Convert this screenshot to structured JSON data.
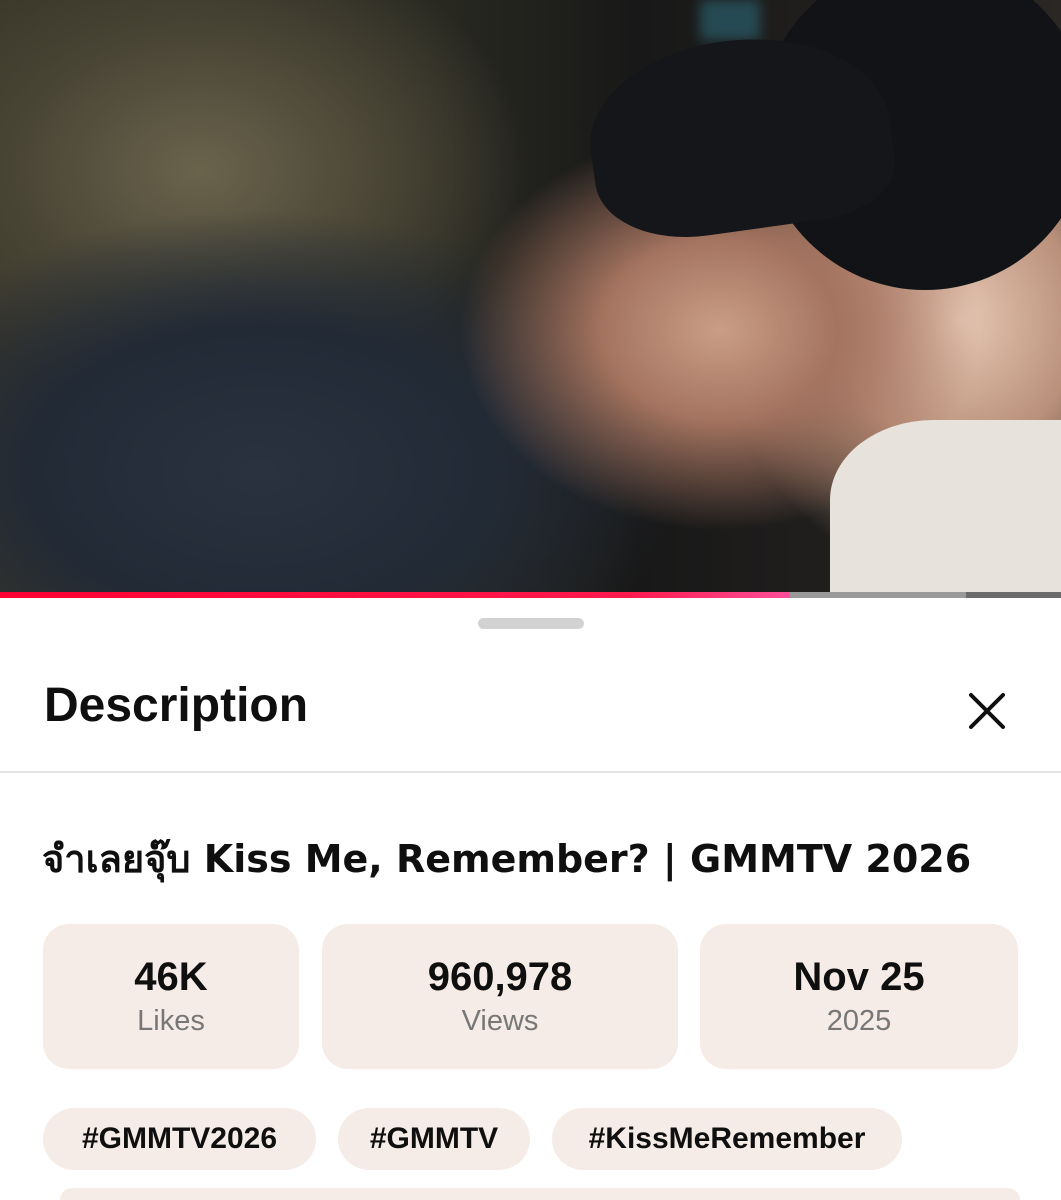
{
  "player": {
    "progress_played": 0.745,
    "progress_buffered": 0.91
  },
  "sheet": {
    "header_title": "Description",
    "close_icon": "close-icon",
    "video_title": "จำเลยจุ๊บ Kiss Me, Remember? | GMMTV 2026",
    "stats": [
      {
        "value": "46K",
        "label": "Likes"
      },
      {
        "value": "960,978",
        "label": "Views"
      },
      {
        "value": "Nov 25",
        "label": "2025"
      }
    ],
    "hashtags": [
      "#GMMTV2026",
      "#GMMTV",
      "#KissMeRemember"
    ]
  },
  "colors": {
    "progress": "#ff0033",
    "chip_bg": "#f6ece7",
    "text": "#0f0f0f",
    "secondary_text": "#777777"
  }
}
